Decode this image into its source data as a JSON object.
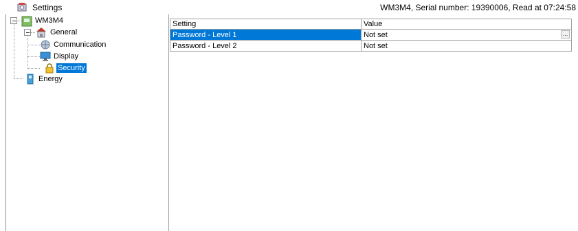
{
  "window": {
    "title": "Settings",
    "info": "WM3M4, Serial number: 19390006, Read at 07:24:58"
  },
  "tree": {
    "root": {
      "label": "WM3M4",
      "icon": "device-icon"
    },
    "general": {
      "label": "General",
      "icon": "home-settings-icon"
    },
    "communication": {
      "label": "Communication",
      "icon": "network-icon"
    },
    "display": {
      "label": "Display",
      "icon": "monitor-icon"
    },
    "security": {
      "label": "Security",
      "icon": "lock-icon",
      "selected": true
    },
    "energy": {
      "label": "Energy",
      "icon": "energy-meter-icon"
    }
  },
  "grid": {
    "columns": [
      "Setting",
      "Value"
    ],
    "rows": [
      {
        "setting": "Password - Level 1",
        "value": "Not set",
        "selected": true,
        "button": "..."
      },
      {
        "setting": "Password - Level 2",
        "value": "Not set",
        "selected": false
      }
    ]
  },
  "colors": {
    "selection": "#0078d7"
  }
}
